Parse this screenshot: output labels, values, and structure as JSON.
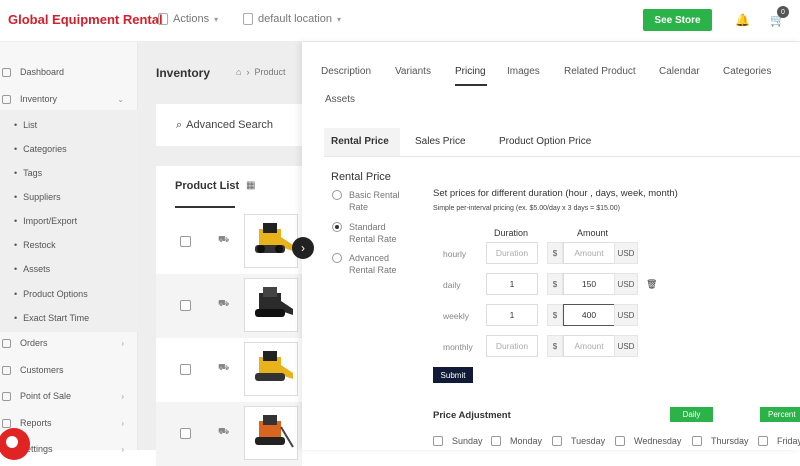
{
  "topbar": {
    "brand": "Global Equipment Rental",
    "actions_label": "Actions",
    "location_label": "default location",
    "see_store": "See Store",
    "cart_count": "0"
  },
  "sidebar": {
    "items": [
      {
        "label": "Dashboard",
        "icon": "dashboard-icon"
      },
      {
        "label": "Inventory",
        "icon": "box-icon"
      },
      {
        "label": "Orders",
        "icon": "orders-icon"
      },
      {
        "label": "Customers",
        "icon": "customers-icon"
      },
      {
        "label": "Point of Sale",
        "icon": "pos-icon"
      },
      {
        "label": "Reports",
        "icon": "reports-icon"
      },
      {
        "label": "Settings",
        "icon": "settings-icon"
      }
    ],
    "inventory_sub": [
      "List",
      "Categories",
      "Tags",
      "Suppliers",
      "Import/Export",
      "Restock",
      "Assets",
      "Product Options",
      "Exact Start Time"
    ]
  },
  "inventory": {
    "title": "Inventory",
    "breadcrumb": "Product",
    "advanced_search": "Advanced Search",
    "product_list": "Product List"
  },
  "tabs": [
    "Description",
    "Variants",
    "Pricing",
    "Images",
    "Related Product",
    "Calendar",
    "Categories",
    "Assets"
  ],
  "subtabs": [
    "Rental Price",
    "Sales Price",
    "Product Option Price"
  ],
  "rental": {
    "title": "Rental Price",
    "options": [
      {
        "label": "Basic Rental Rate",
        "selected": false
      },
      {
        "label": "Standard Rental Rate",
        "selected": true
      },
      {
        "label": "Advanced Rental Rate",
        "selected": false
      }
    ],
    "heading": "Set prices for different duration (hour , days, week, month)",
    "simple_note": "Simple per-interval pricing (ex. $5.00/day x 3 days = $15.00)",
    "col_duration": "Duration",
    "col_amount": "Amount",
    "currency_symbol": "$",
    "currency": "USD",
    "rows": [
      {
        "label": "hourly",
        "duration": "",
        "duration_ph": "Duration",
        "amount": "",
        "amount_ph": "Amount"
      },
      {
        "label": "daily",
        "duration": "1",
        "duration_ph": "",
        "amount": "150",
        "amount_ph": ""
      },
      {
        "label": "weekly",
        "duration": "1",
        "duration_ph": "",
        "amount": "400",
        "amount_ph": ""
      },
      {
        "label": "monthly",
        "duration": "",
        "duration_ph": "Duration",
        "amount": "",
        "amount_ph": "Amount"
      }
    ],
    "submit": "Submit"
  },
  "price_adjustment": {
    "title": "Price Adjustment",
    "daily_btn": "Daily",
    "percent_btn": "Percent",
    "days": [
      "Sunday",
      "Monday",
      "Tuesday",
      "Wednesday",
      "Thursday",
      "Friday"
    ]
  },
  "colors": {
    "brand": "#d4202b",
    "green": "#2bb34a",
    "submit": "#111a36"
  }
}
